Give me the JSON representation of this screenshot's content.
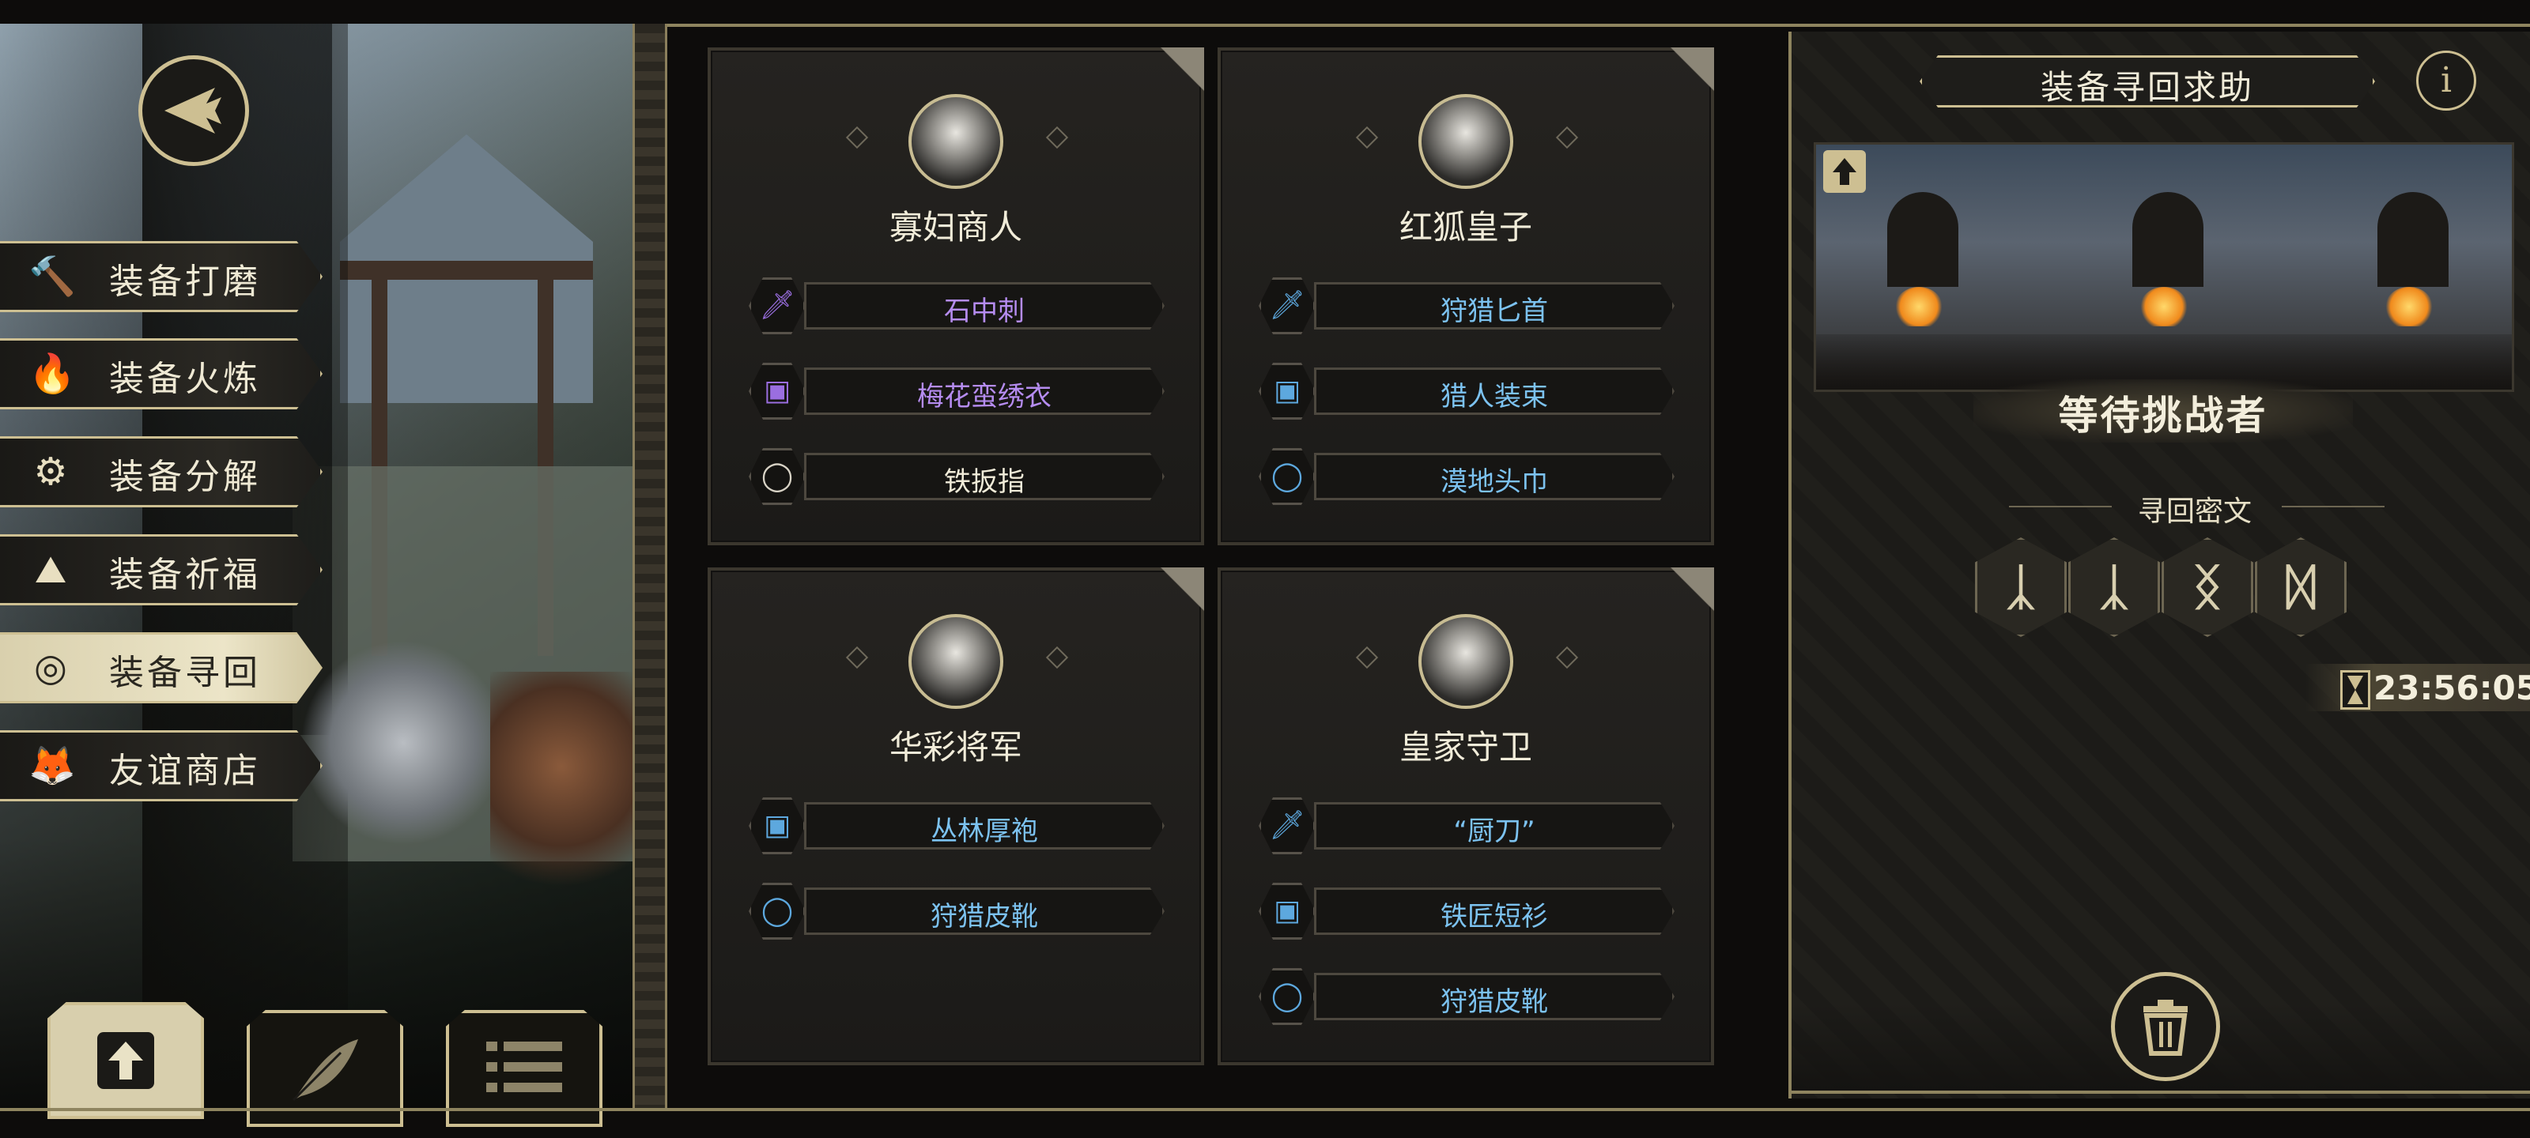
{
  "side_menu": {
    "items": [
      {
        "label": "装备打磨",
        "icon": "hammer-icon",
        "active": false
      },
      {
        "label": "装备火炼",
        "icon": "flame-icon",
        "active": false
      },
      {
        "label": "装备分解",
        "icon": "broken-gear-icon",
        "active": false
      },
      {
        "label": "装备祈福",
        "icon": "praying-hands-icon",
        "active": false
      },
      {
        "label": "装备寻回",
        "icon": "target-spiral-icon",
        "active": true
      },
      {
        "label": "友谊商店",
        "icon": "fox-head-icon",
        "active": false
      }
    ]
  },
  "bottom_tools": [
    {
      "icon": "upload-arrow-icon",
      "active": true
    },
    {
      "icon": "feather-icon",
      "active": false
    },
    {
      "icon": "list-icon",
      "active": false
    }
  ],
  "npcs": [
    {
      "name": "寡妇商人",
      "items": [
        {
          "label": "石中刺",
          "icon": "sword-icon",
          "color": "#b58cf0"
        },
        {
          "label": "梅花蛮绣衣",
          "icon": "armor-icon",
          "color": "#b58cf0"
        },
        {
          "label": "铁扳指",
          "icon": "ring-icon",
          "color": "#f1ecd9"
        }
      ]
    },
    {
      "name": "红狐皇子",
      "items": [
        {
          "label": "狩猎匕首",
          "icon": "sword-icon",
          "color": "#7cc2f0"
        },
        {
          "label": "猎人装束",
          "icon": "armor-icon",
          "color": "#7cc2f0"
        },
        {
          "label": "漠地头巾",
          "icon": "ring-icon",
          "color": "#7cc2f0"
        }
      ]
    },
    {
      "name": "华彩将军",
      "items": [
        {
          "label": "丛林厚袍",
          "icon": "armor-icon",
          "color": "#7cc2f0"
        },
        {
          "label": "狩猎皮靴",
          "icon": "ring-icon",
          "color": "#7cc2f0"
        }
      ]
    },
    {
      "name": "皇家守卫",
      "items": [
        {
          "label": "“厨刀”",
          "icon": "sword-icon",
          "color": "#7cc2f0"
        },
        {
          "label": "铁匠短衫",
          "icon": "armor-icon",
          "color": "#7cc2f0"
        },
        {
          "label": "狩猎皮靴",
          "icon": "ring-icon",
          "color": "#7cc2f0"
        }
      ]
    }
  ],
  "right_panel": {
    "title": "装备寻回求助",
    "status": "等待挑战者",
    "cipher_label": "寻回密文",
    "cipher_runes": [
      "ᛣ",
      "ᛣ",
      "ᛝ",
      "ᛞ"
    ],
    "timer": "23:56:05"
  },
  "colors": {
    "gold": "#cdbf92",
    "purple_item": "#b58cf0",
    "blue_item": "#7cc2f0"
  }
}
